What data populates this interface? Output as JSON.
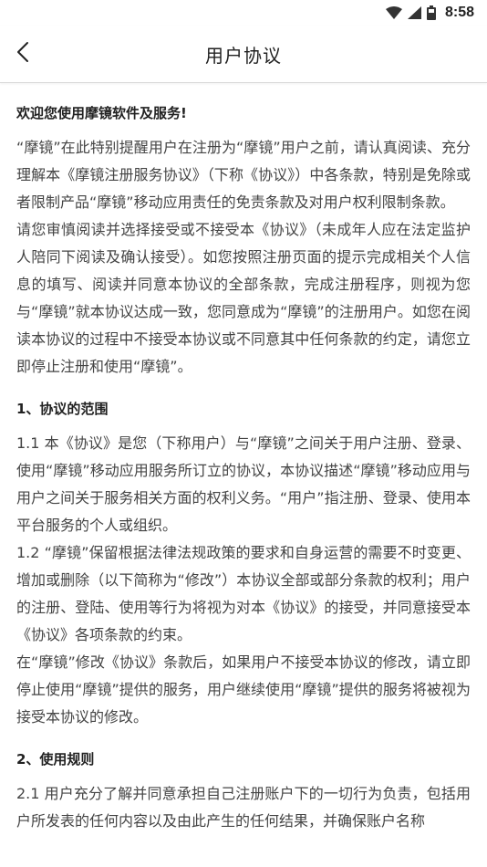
{
  "status": {
    "time": "8:58",
    "icons": [
      "wifi-icon",
      "signal-icon",
      "battery-icon"
    ]
  },
  "header": {
    "back_icon": "chevron-left-icon",
    "title": "用户协议"
  },
  "content": {
    "intro_title": "欢迎您使用摩镜软件及服务!",
    "intro_paragraphs": [
      "“摩镜”在此特别提醒用户在注册为“摩镜”用户之前，请认真阅读、充分理解本《摩镜注册服务协议》（下称《协议》）中各条款，特别是免除或者限制产品“摩镜”移动应用责任的免责条款及对用户权利限制条款。",
      "请您审慎阅读并选择接受或不接受本《协议》（未成年人应在法定监护人陪同下阅读及确认接受）。如您按照注册页面的提示完成相关个人信息的填写、阅读并同意本协议的全部条款，完成注册程序，则视为您与“摩镜”就本协议达成一致，您同意成为“摩镜”的注册用户。如您在阅读本协议的过程中不接受本协议或不同意其中任何条款的约定，请您立即停止注册和使用“摩镜”。"
    ],
    "section1_title": "1、协议的范围",
    "section1_paragraphs": [
      "1.1 本《协议》是您（下称用户）与“摩镜”之间关于用户注册、登录、使用“摩镜”移动应用服务所订立的协议，本协议描述“摩镜”移动应用与用户之间关于服务相关方面的权利义务。“用户”指注册、登录、使用本平台服务的个人或组织。",
      "1.2 “摩镜”保留根据法律法规政策的要求和自身运营的需要不时变更、增加或删除（以下简称为“修改”）本协议全部或部分条款的权利；用户的注册、登陆、使用等行为将视为对本《协议》的接受，并同意接受本《协议》各项条款的约束。",
      "在“摩镜”修改《协议》条款后，如果用户不接受本协议的修改，请立即停止使用“摩镜”提供的服务，用户继续使用“摩镜”提供的服务将被视为接受本协议的修改。"
    ],
    "section2_title": "2、使用规则",
    "section2_paragraphs": [
      "2.1 用户充分了解并同意承担自己注册账户下的一切行为负责，包括用户所发表的任何内容以及由此产生的任何结果，并确保账户名称"
    ]
  }
}
